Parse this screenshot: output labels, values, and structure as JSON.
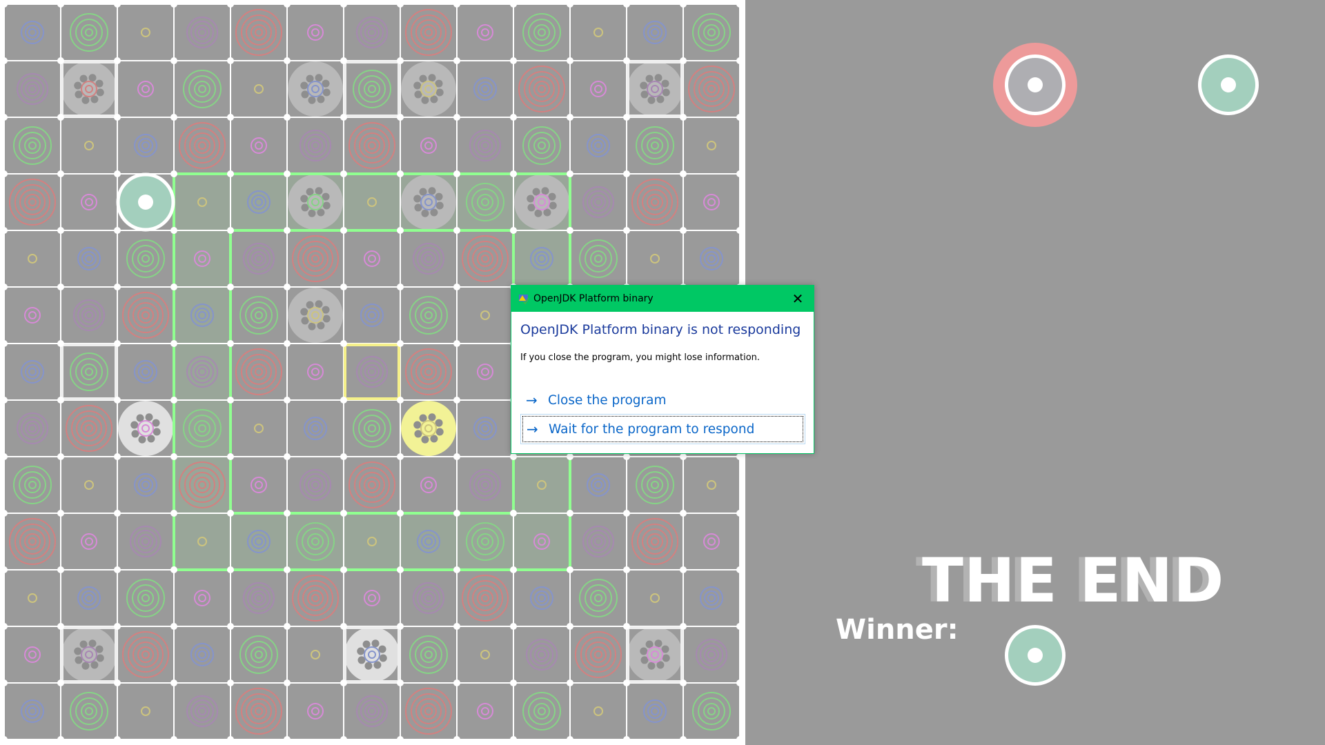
{
  "board": {
    "size": 13,
    "ring_colors": {
      "Y": "#cdc47e",
      "P": "#d88ad8",
      "B": "#8594cc",
      "U": "#a886b4",
      "G": "#86d486",
      "R": "#d48080"
    },
    "rows": [
      "BGYURPURPGYBG",
      "URPGYBGYBRPUR",
      "GYBRPURPUGBGY",
      "RPGYBGYBGPURP",
      "YBGPURPURBGYB",
      "PURBGYBGYURPU",
      "BGBURPURPGYBG",
      "URPGYBGYBRPUR",
      "GYBRPURPUYBGY",
      "RPUYBGYBGPURP",
      "YBGPURPURBGYB",
      "PURBGYBGYURPU",
      "BGYURPURPGYBG"
    ],
    "tokens": [
      {
        "row": 1,
        "col": 1,
        "fill": "#b9b9b9"
      },
      {
        "row": 1,
        "col": 5,
        "fill": "#b9b9b9"
      },
      {
        "row": 1,
        "col": 7,
        "fill": "#b9b9b9"
      },
      {
        "row": 1,
        "col": 11,
        "fill": "#b9b9b9"
      },
      {
        "row": 3,
        "col": 5,
        "fill": "#b9b9b9"
      },
      {
        "row": 3,
        "col": 7,
        "fill": "#b9b9b9"
      },
      {
        "row": 3,
        "col": 9,
        "fill": "#b9b9b9"
      },
      {
        "row": 5,
        "col": 5,
        "fill": "#b9b9b9"
      },
      {
        "row": 7,
        "col": 2,
        "fill": "#e0e0e0"
      },
      {
        "row": 7,
        "col": 7,
        "fill": "#f2f296"
      },
      {
        "row": 11,
        "col": 1,
        "fill": "#b9b9b9"
      },
      {
        "row": 11,
        "col": 6,
        "fill": "#e0e0e0"
      },
      {
        "row": 11,
        "col": 11,
        "fill": "#b9b9b9"
      }
    ],
    "white_boxes": [
      [
        1,
        1
      ],
      [
        1,
        6
      ],
      [
        1,
        11
      ],
      [
        6,
        1
      ],
      [
        11,
        1
      ],
      [
        11,
        6
      ],
      [
        11,
        11
      ]
    ],
    "yellow_boxes": [
      [
        6,
        6
      ]
    ],
    "territory": {
      "outer": [
        3,
        3,
        10,
        10
      ],
      "inner": [
        4,
        4,
        9,
        9
      ],
      "color": "#90ff90"
    },
    "player_piece": {
      "row": 3,
      "col": 2,
      "color": "#a3cfbd"
    }
  },
  "side": {
    "players": [
      {
        "color": "#aeaeb2",
        "highlight": "#ed9a9a",
        "active": true
      },
      {
        "color": "#a3cfbd",
        "active": false
      }
    ],
    "end_title": "THE END",
    "winner_label": "Winner:",
    "winner_color": "#a3cfbd"
  },
  "dialog": {
    "title": "OpenJDK Platform binary",
    "heading": "OpenJDK Platform binary is not responding",
    "body": "If you close the program, you might lose information.",
    "options": [
      {
        "label": "Close the program",
        "arrow": "→"
      },
      {
        "label": "Wait for the program to respond",
        "arrow": "→"
      }
    ],
    "close_glyph": "✕",
    "title_bar_color": "#00c864"
  }
}
